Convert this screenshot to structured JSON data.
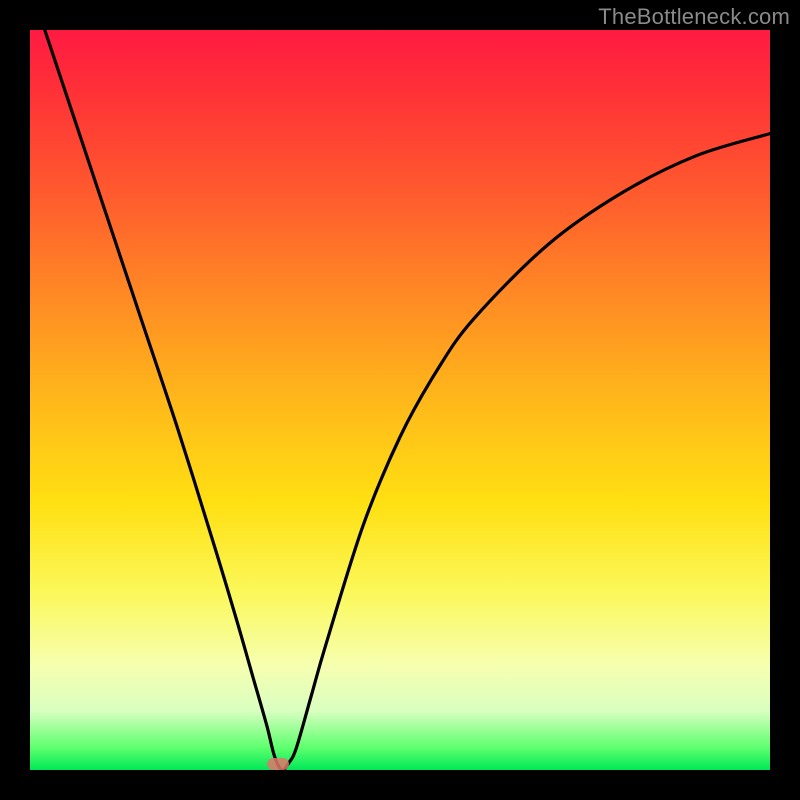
{
  "watermark": "TheBottleneck.com",
  "colors": {
    "background": "#000000",
    "gradient_top": "#ff1a42",
    "gradient_bottom": "#00e858",
    "curve": "#000000",
    "marker": "#e0776b"
  },
  "chart_data": {
    "type": "line",
    "title": "",
    "xlabel": "",
    "ylabel": "",
    "xlim": [
      0,
      100
    ],
    "ylim": [
      0,
      100
    ],
    "legend": false,
    "grid": false,
    "series": [
      {
        "name": "bottleneck-curve",
        "x": [
          2,
          5,
          10,
          15,
          20,
          25,
          28,
          30,
          32,
          33,
          34,
          35,
          36,
          38,
          40,
          45,
          50,
          55,
          60,
          70,
          80,
          90,
          100
        ],
        "y": [
          100,
          91,
          76,
          61,
          46,
          30,
          20,
          13,
          6,
          2,
          0,
          1,
          3,
          10,
          17,
          33,
          45,
          54,
          61,
          71,
          78,
          83,
          86
        ]
      }
    ],
    "annotations": [
      {
        "name": "minimum-marker",
        "x": 33.5,
        "y": 0.5
      }
    ]
  }
}
